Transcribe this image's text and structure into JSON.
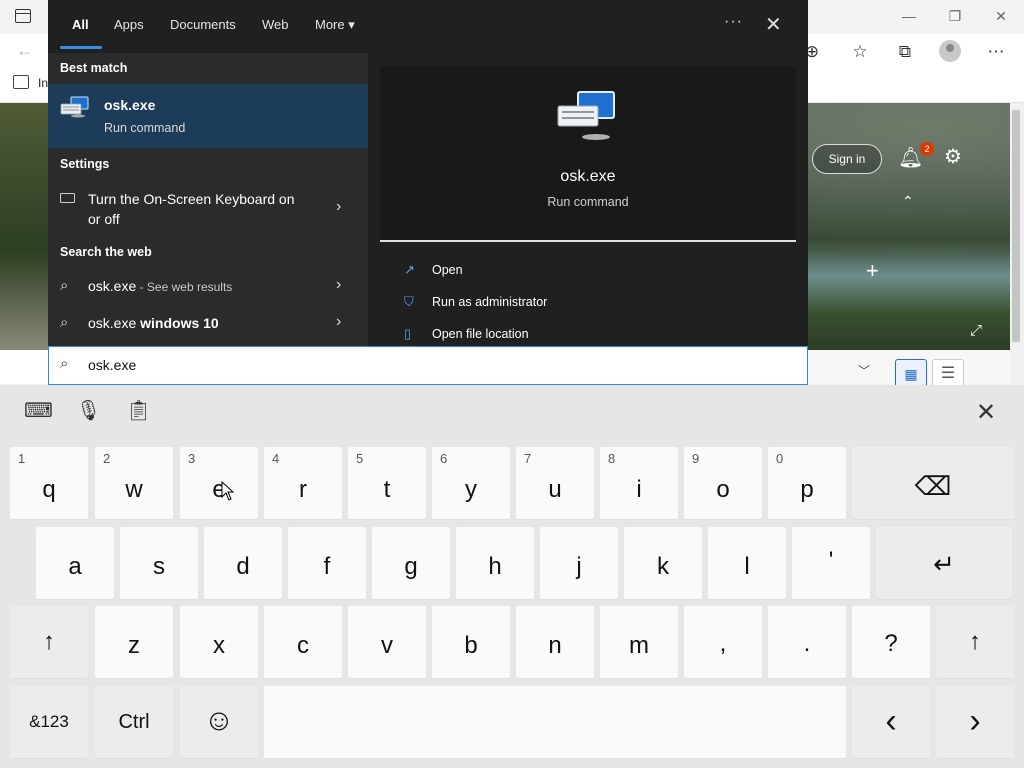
{
  "search": {
    "tabs": [
      "All",
      "Apps",
      "Documents",
      "Web",
      "More"
    ],
    "more_caret": "▾",
    "menu_glyph": "···",
    "close_glyph": "✕",
    "best_match_heading": "Best match",
    "best_match": {
      "title": "osk.exe",
      "subtitle": "Run command"
    },
    "settings_heading": "Settings",
    "settings_item": {
      "line1": "Turn the On-Screen Keyboard on",
      "line2": "or off"
    },
    "web_heading": "Search the web",
    "web_items": [
      {
        "label": "osk.exe",
        "suffix": " - See web results"
      },
      {
        "label": "osk.exe ",
        "suffix_bold": "windows 10"
      }
    ],
    "preview": {
      "title": "osk.exe",
      "subtitle": "Run command"
    },
    "actions": [
      "Open",
      "Run as administrator",
      "Open file location"
    ],
    "query": "osk.exe",
    "accent_color": "#3a8ee6",
    "selected_color": "#1c3c5a"
  },
  "browser": {
    "signin_label": "Sign in",
    "notification_count": "2",
    "fav_text": "In"
  },
  "keyboard": {
    "row1": [
      {
        "num": "1",
        "key": "q"
      },
      {
        "num": "2",
        "key": "w"
      },
      {
        "num": "3",
        "key": "e"
      },
      {
        "num": "4",
        "key": "r"
      },
      {
        "num": "5",
        "key": "t"
      },
      {
        "num": "6",
        "key": "y"
      },
      {
        "num": "7",
        "key": "u"
      },
      {
        "num": "8",
        "key": "i"
      },
      {
        "num": "9",
        "key": "o"
      },
      {
        "num": "0",
        "key": "p"
      }
    ],
    "row2": [
      "a",
      "s",
      "d",
      "f",
      "g",
      "h",
      "j",
      "k",
      "l",
      "'"
    ],
    "row3": [
      "z",
      "x",
      "c",
      "v",
      "b",
      "n",
      "m",
      ",",
      ".",
      "?"
    ],
    "backspace": "⌫",
    "enter": "↵",
    "shift": "↑",
    "num_sym": "&123",
    "ctrl": "Ctrl",
    "emoji": "☺",
    "left": "‹",
    "right": "›",
    "close": "✕",
    "tools": [
      "keyboard-settings-icon",
      "microphone-icon",
      "clipboard-icon"
    ]
  }
}
